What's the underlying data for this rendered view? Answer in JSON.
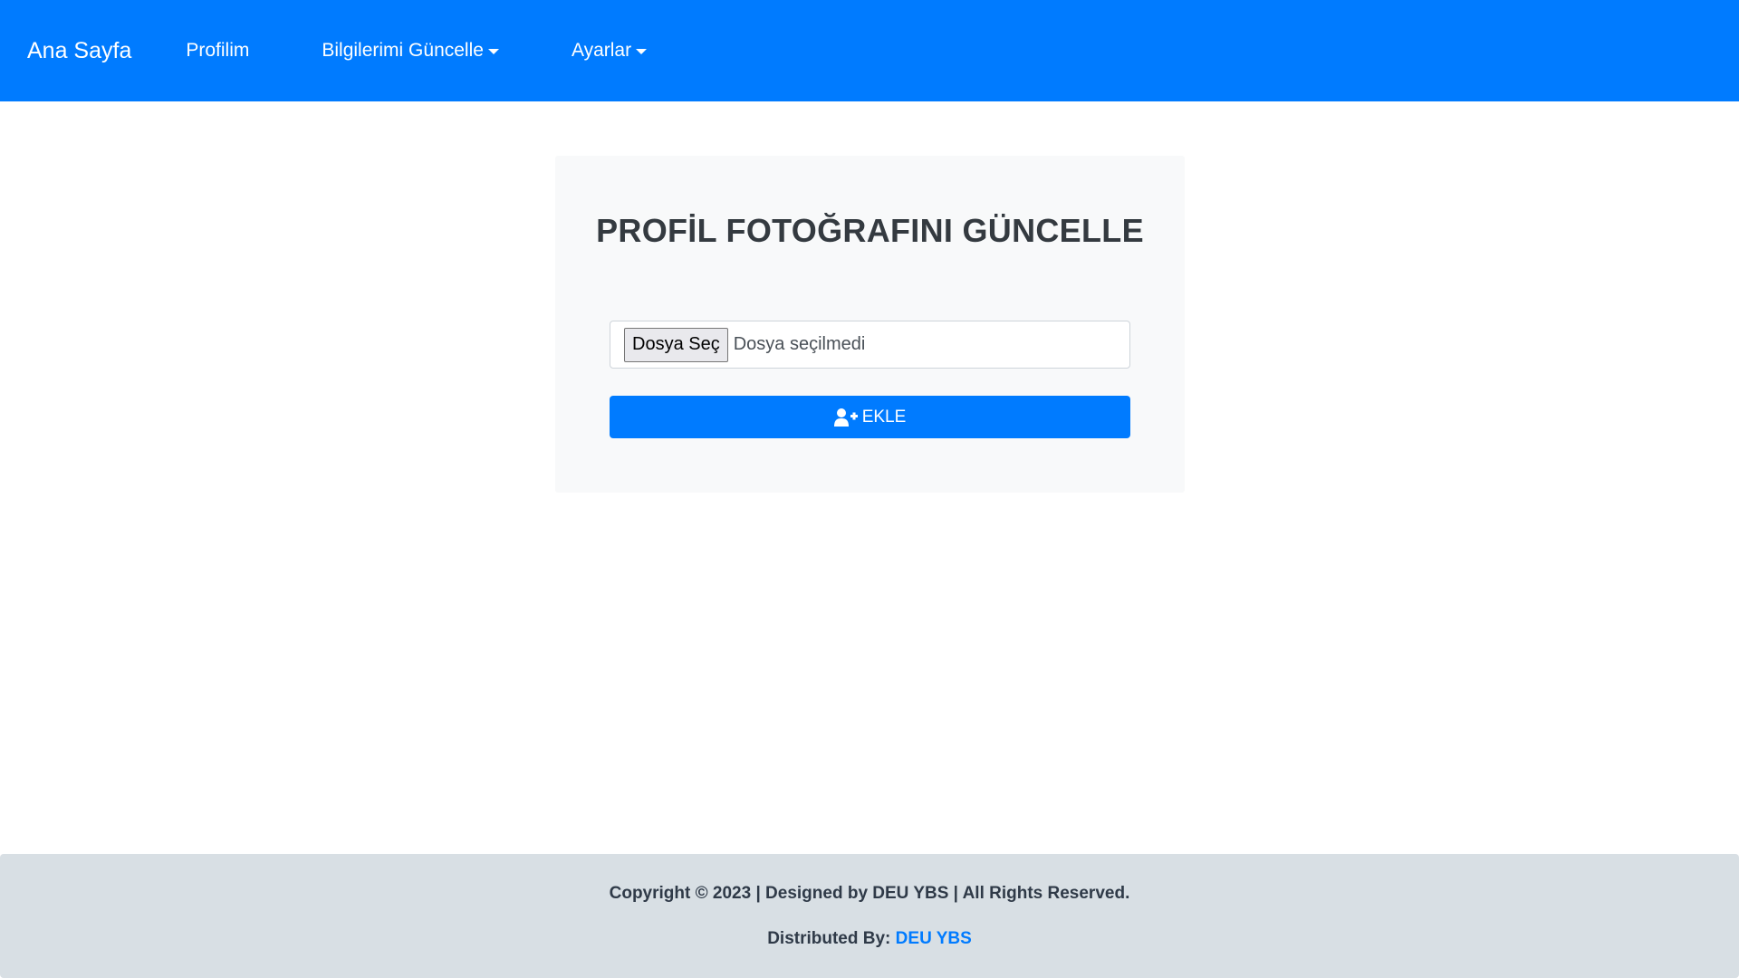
{
  "navbar": {
    "brand": "Ana Sayfa",
    "items": [
      {
        "label": "Profilim",
        "dropdown": false
      },
      {
        "label": "Bilgilerimi Güncelle",
        "dropdown": true
      },
      {
        "label": "Ayarlar",
        "dropdown": true
      }
    ]
  },
  "form": {
    "title": "PROFİL FOTOĞRAFINI GÜNCELLE",
    "file_button_label": "Dosya Seç",
    "file_status": "Dosya seçilmedi",
    "submit_label": "EKLE",
    "submit_icon": "user-plus-icon"
  },
  "footer": {
    "copyright": "Copyright © 2023 | Designed by DEU YBS | All Rights Reserved.",
    "distributed_prefix": "Distributed By:",
    "distributed_link": "DEU YBS"
  },
  "colors": {
    "primary": "#007bff",
    "card_bg": "#f8f9fa",
    "footer_bg": "#d8dfe4"
  }
}
